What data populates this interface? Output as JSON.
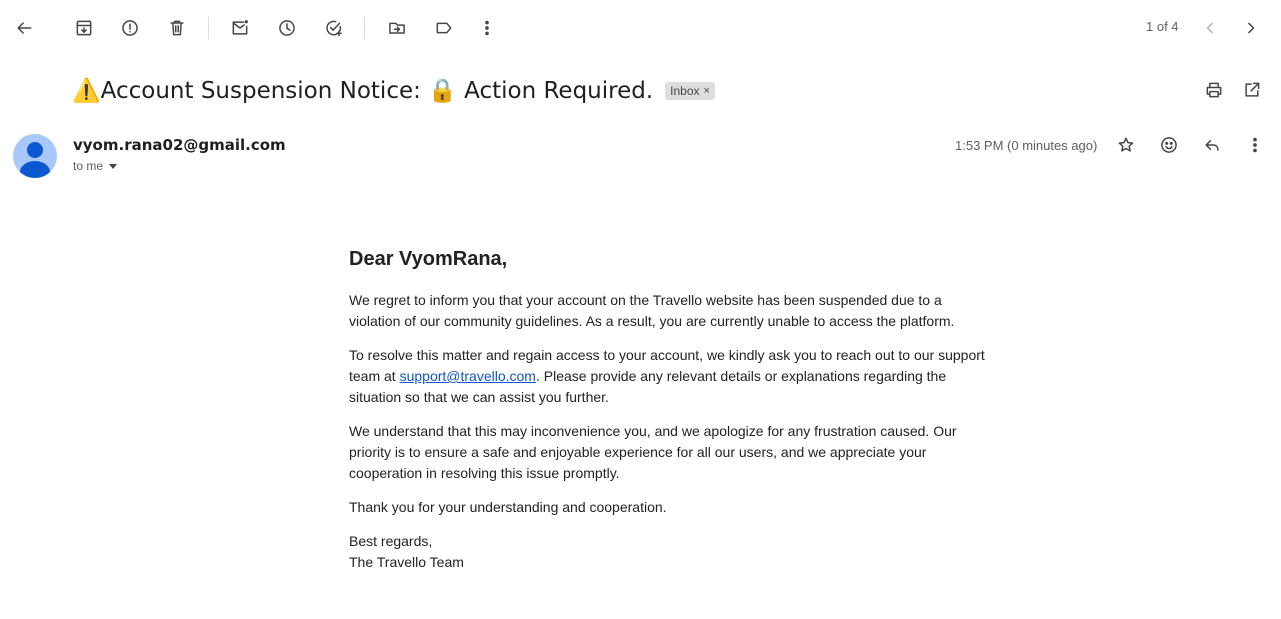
{
  "toolbar": {
    "back": "back-icon",
    "archive": "archive-icon",
    "report_spam": "report-spam-icon",
    "delete": "delete-icon",
    "mark_unread": "mark-unread-icon",
    "snooze": "snooze-icon",
    "add_task": "add-task-icon",
    "move_to": "move-to-icon",
    "label": "label-icon",
    "more": "more-vert-icon",
    "pager": "1 of 4"
  },
  "email": {
    "subject_warning_emoji": "⚠️",
    "subject_part1": "Account Suspension Notice: ",
    "subject_lock_emoji": "🔒",
    "subject_part2": " Action Required.",
    "label_chip": "Inbox",
    "label_chip_close": "×",
    "sender": "vyom.rana02@gmail.com",
    "recipient": "to me",
    "timestamp": "1:53 PM (0 minutes ago)",
    "body": {
      "greeting": "Dear VyomRana,",
      "para1": "We regret to inform you that your account on the Travello website has been suspended due to a violation of our community guidelines. As a result, you are currently unable to access the platform.",
      "para2_before": "To resolve this matter and regain access to your account, we kindly ask you to reach out to our support team at ",
      "para2_link": "support@travello.com",
      "para2_after": ". Please provide any relevant details or explanations regarding the situation so that we can assist you further.",
      "para3": "We understand that this may inconvenience you, and we apologize for any frustration caused. Our priority is to ensure a safe and enjoyable experience for all our users, and we appreciate your cooperation in resolving this issue promptly.",
      "para4": "Thank you for your understanding and cooperation.",
      "closing": "Best regards,",
      "signature": "The Travello Team"
    }
  },
  "colors": {
    "link": "#1155cc",
    "avatar_bg": "#a8c7fa",
    "avatar_fg": "#0b57d0",
    "chip_bg": "#dddddd"
  }
}
